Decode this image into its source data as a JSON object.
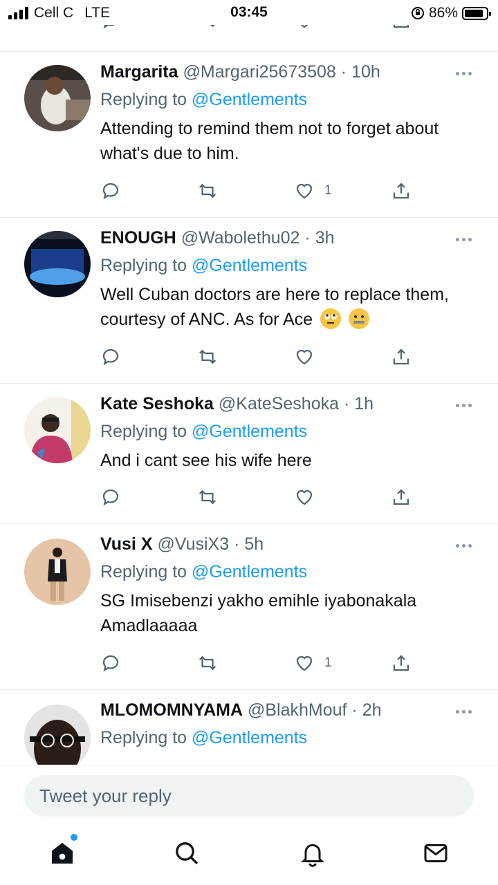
{
  "status_bar": {
    "carrier": "Cell C",
    "network": "LTE",
    "time": "03:45",
    "battery": "86%",
    "battery_level": 0.86
  },
  "tweets": [
    {
      "name": "Margarita",
      "handle": "@Margari25673508",
      "time": "10h",
      "replying_prefix": "Replying to",
      "replying_to": "@Gentlements",
      "text": "Attending to remind them not to forget about what's due to him.",
      "like_count": "1"
    },
    {
      "name": "ENOUGH",
      "handle": "@Wabolethu02",
      "time": "3h",
      "replying_prefix": "Replying to",
      "replying_to": "@Gentlements",
      "text": "Well Cuban doctors are here to replace them, courtesy of ANC. As for Ace",
      "like_count": ""
    },
    {
      "name": "Kate Seshoka",
      "handle": "@KateSeshoka",
      "time": "1h",
      "replying_prefix": "Replying to",
      "replying_to": "@Gentlements",
      "text": "And i cant see his wife here",
      "like_count": ""
    },
    {
      "name": "Vusi X",
      "handle": "@VusiX3",
      "time": "5h",
      "replying_prefix": "Replying to",
      "replying_to": "@Gentlements",
      "text": "SG Imisebenzi yakho emihle iyabonakala Amadlaaaaa",
      "like_count": "1"
    },
    {
      "name": "MLOMOMNYAMA",
      "handle": "@BlakhMouf",
      "time": "2h",
      "replying_prefix": "Replying to",
      "replying_to": "@Gentlements"
    }
  ],
  "compose": {
    "placeholder": "Tweet your reply"
  },
  "tabbar": [
    "home-icon",
    "search-icon",
    "notifications-icon",
    "messages-icon"
  ],
  "colors": {
    "link": "#1d9bf0",
    "muted": "#536471",
    "text": "#0f1419"
  }
}
